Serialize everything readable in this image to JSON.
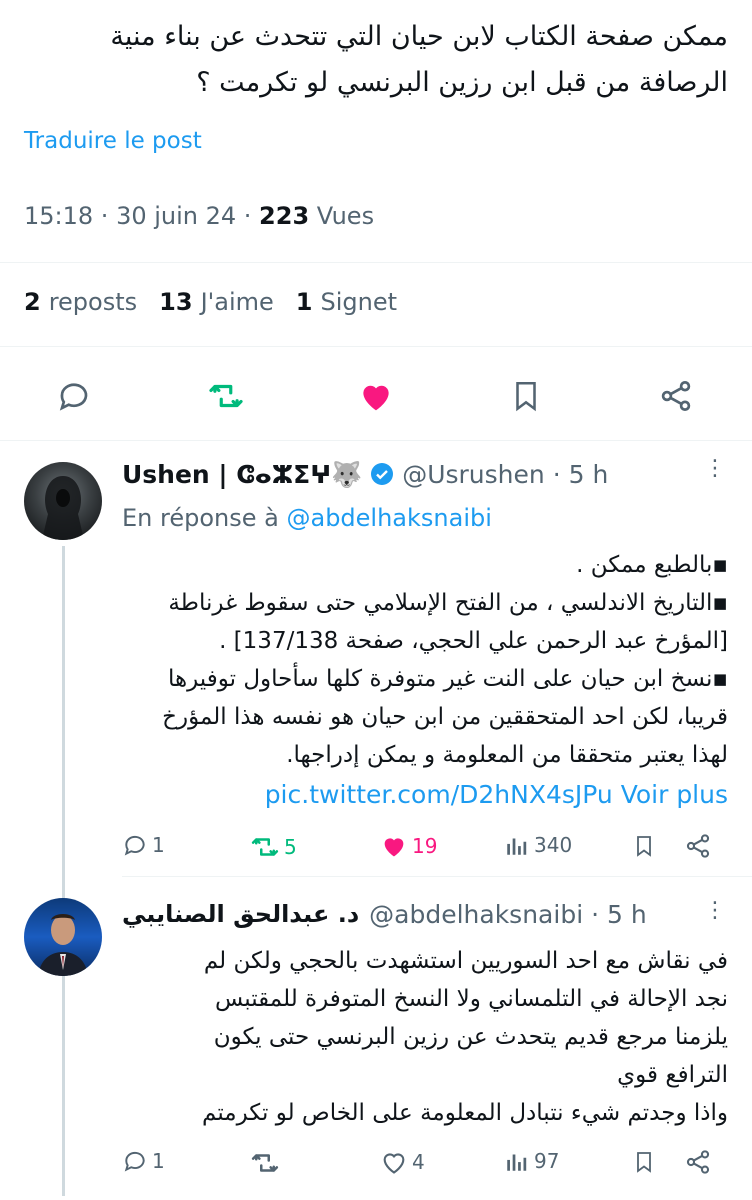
{
  "post": {
    "text": "ممكن صفحة الكتاب لابن حيان التي تتحدث عن بناء منية\nالرصافة من قبل ابن رزين البرنسي لو تكرمت ؟",
    "translate_label": "Traduire le post",
    "time": "15:18",
    "date": "30 juin 24",
    "views_count": "223",
    "views_label": "Vues",
    "reposts_count": "2",
    "reposts_label": "reposts",
    "likes_count": "13",
    "likes_label": "J'aime",
    "bookmarks_count": "1",
    "bookmarks_label": "Signet"
  },
  "colors": {
    "accent": "#1d9bf0",
    "retweet": "#00ba7c",
    "like": "#f91880",
    "muted": "#536471"
  },
  "replies": [
    {
      "name": "Ushen | ⵛⴰⵣⵉⵖ🐺",
      "handle": "@Usrushen",
      "time": "· 5 h",
      "reply_to_label": "En réponse à",
      "reply_to_handle": "@abdelhaksnaibi",
      "text": "▪بالطبع ممكن .\n▪التاريخ الاندلسي ، من الفتح الإسلامي حتى سقوط غرناطة\n[المؤرخ عبد الرحمن علي الحجي، صفحة 137/138] .\n▪نسخ ابن حيان على النت غير متوفرة كلها سأحاول توفيرها\nقريبا، لكن احد المتحققين من ابن حيان هو نفسه هذا المؤرخ\nلهذا يعتبر متحققا من المعلومة و يمكن إدراجها.",
      "link": "pic.twitter.com/D2hNX4sJPu",
      "see_more": "Voir plus",
      "replies": "1",
      "retweets": "5",
      "likes": "19",
      "views": "340"
    },
    {
      "name": "د. عبدالحق الصنايبي",
      "handle": "@abdelhaksnaibi",
      "time": "· 5 h",
      "text": "في نقاش مع احد السوريين استشهدت بالحجي ولكن لم\nنجد الإحالة في التلمساني ولا النسخ المتوفرة للمقتبس\nيلزمنا مرجع قديم يتحدث عن رزين البرنسي حتى يكون\nالترافع قوي\nواذا وجدتم شيء نتبادل المعلومة على الخاص لو تكرمتم",
      "replies": "1",
      "retweets": "",
      "likes": "4",
      "views": "97"
    }
  ]
}
